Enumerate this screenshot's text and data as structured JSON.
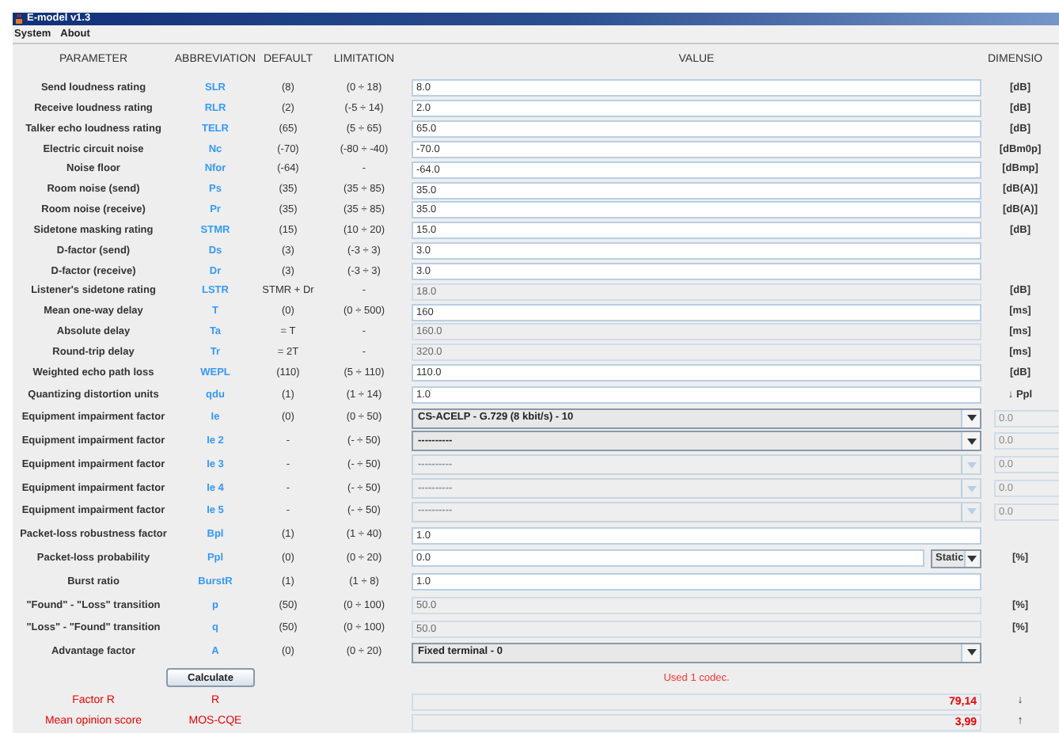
{
  "window": {
    "title": "E-model v1.3"
  },
  "menu": [
    "System",
    "About"
  ],
  "columns": [
    "PARAMETER",
    "ABBREVIATION",
    "DEFAULT",
    "LIMITATION",
    "VALUE",
    "DIMENSIO"
  ],
  "rows": [
    {
      "parameter": "Send loudness rating",
      "abbreviation": "SLR",
      "default": "(8)",
      "limitation": "(0 ÷ 18)",
      "kind": "input",
      "value": "8.0",
      "dimension": "[dB]"
    },
    {
      "parameter": "Receive loudness rating",
      "abbreviation": "RLR",
      "default": "(2)",
      "limitation": "(-5 ÷ 14)",
      "kind": "input",
      "value": "2.0",
      "dimension": "[dB]"
    },
    {
      "parameter": "Talker echo loudness rating",
      "abbreviation": "TELR",
      "default": "(65)",
      "limitation": "(5 ÷ 65)",
      "kind": "input",
      "value": "65.0",
      "dimension": "[dB]"
    },
    {
      "parameter": "Electric circuit noise",
      "abbreviation": "Nc",
      "default": "(-70)",
      "limitation": "(-80 ÷ -40)",
      "kind": "input",
      "value": "-70.0",
      "dimension": "[dBm0p]"
    },
    {
      "parameter": "Noise floor",
      "abbreviation": "Nfor",
      "default": "(-64)",
      "limitation": "-",
      "kind": "input",
      "value": "-64.0",
      "dimension": "[dBmp]"
    },
    {
      "parameter": "Room noise (send)",
      "abbreviation": "Ps",
      "default": "(35)",
      "limitation": "(35 ÷ 85)",
      "kind": "input",
      "value": "35.0",
      "dimension": "[dB(A)]"
    },
    {
      "parameter": "Room noise (receive)",
      "abbreviation": "Pr",
      "default": "(35)",
      "limitation": "(35 ÷ 85)",
      "kind": "input",
      "value": "35.0",
      "dimension": "[dB(A)]"
    },
    {
      "parameter": "Sidetone masking rating",
      "abbreviation": "STMR",
      "default": "(15)",
      "limitation": "(10 ÷ 20)",
      "kind": "input",
      "value": "15.0",
      "dimension": "[dB]"
    },
    {
      "parameter": "D-factor (send)",
      "abbreviation": "Ds",
      "default": "(3)",
      "limitation": "(-3 ÷ 3)",
      "kind": "input",
      "value": "3.0"
    },
    {
      "parameter": "D-factor (receive)",
      "abbreviation": "Dr",
      "default": "(3)",
      "limitation": "(-3 ÷ 3)",
      "kind": "input",
      "value": "3.0"
    },
    {
      "parameter": "Listener's sidetone rating",
      "abbreviation": "LSTR",
      "default": "STMR + Dr",
      "limitation": "-",
      "kind": "readonly",
      "value": "18.0",
      "dimension": "[dB]"
    },
    {
      "parameter": "Mean one-way delay",
      "abbreviation": "T",
      "default": "(0)",
      "limitation": "(0 ÷ 500)",
      "kind": "input",
      "value": "160",
      "dimension": "[ms]"
    },
    {
      "parameter": "Absolute delay",
      "abbreviation": "Ta",
      "default": "= T",
      "limitation": "-",
      "kind": "readonly",
      "value": "160.0",
      "dimension": "[ms]"
    },
    {
      "parameter": "Round-trip delay",
      "abbreviation": "Tr",
      "default": "= 2T",
      "limitation": "-",
      "kind": "readonly",
      "value": "320.0",
      "dimension": "[ms]"
    },
    {
      "parameter": "Weighted echo path loss",
      "abbreviation": "WEPL",
      "default": "(110)",
      "limitation": "(5 ÷ 110)",
      "kind": "input",
      "value": "110.0",
      "dimension": "[dB]"
    },
    {
      "parameter": "Quantizing distortion units",
      "abbreviation": "qdu",
      "default": "(1)",
      "limitation": "(1 ÷ 14)",
      "kind": "input",
      "value": "1.0",
      "dimension": "↓ Ppl"
    },
    {
      "parameter": "Equipment impairment factor",
      "abbreviation": "Ie",
      "default": "(0)",
      "limitation": "(0 ÷ 50)",
      "kind": "select",
      "disabled": false,
      "value": "CS-ACELP - G.729 (8 kbit/s) - 10",
      "side_value": "0.0"
    },
    {
      "parameter": "Equipment impairment factor",
      "abbreviation": "Ie 2",
      "default": "-",
      "limitation": "(- ÷ 50)",
      "kind": "select",
      "disabled": false,
      "value": "----------",
      "side_value": "0.0"
    },
    {
      "parameter": "Equipment impairment factor",
      "abbreviation": "Ie 3",
      "default": "-",
      "limitation": "(- ÷ 50)",
      "kind": "select",
      "disabled": true,
      "value": "----------",
      "side_value": "0.0"
    },
    {
      "parameter": "Equipment impairment factor",
      "abbreviation": "Ie 4",
      "default": "-",
      "limitation": "(- ÷ 50)",
      "kind": "select",
      "disabled": true,
      "value": "----------",
      "side_value": "0.0"
    },
    {
      "parameter": "Equipment impairment factor",
      "abbreviation": "Ie 5",
      "default": "-",
      "limitation": "(- ÷ 50)",
      "kind": "select",
      "disabled": true,
      "value": "----------",
      "side_value": "0.0"
    },
    {
      "parameter": "Packet-loss robustness factor",
      "abbreviation": "Bpl",
      "default": "(1)",
      "limitation": "(1 ÷ 40)",
      "kind": "input",
      "value": "1.0"
    },
    {
      "parameter": "Packet-loss probability",
      "abbreviation": "Ppl",
      "default": "(0)",
      "limitation": "(0 ÷ 20)",
      "kind": "input_mode",
      "value": "0.0",
      "mode": "Static",
      "dimension": "[%]"
    },
    {
      "parameter": "Burst ratio",
      "abbreviation": "BurstR",
      "default": "(1)",
      "limitation": "(1 ÷ 8)",
      "kind": "input",
      "value": "1.0"
    },
    {
      "parameter": "\"Found\" - \"Loss\" transition",
      "abbreviation": "p",
      "default": "(50)",
      "limitation": "(0 ÷ 100)",
      "kind": "readonly",
      "value": "50.0",
      "dimension": "[%]"
    },
    {
      "parameter": "\"Loss\" - \"Found\" transition",
      "abbreviation": "q",
      "default": "(50)",
      "limitation": "(0 ÷ 100)",
      "kind": "readonly",
      "value": "50.0",
      "dimension": "[%]"
    },
    {
      "parameter": "Advantage factor",
      "abbreviation": "A",
      "default": "(0)",
      "limitation": "(0 ÷ 20)",
      "kind": "select",
      "disabled": false,
      "value": "Fixed terminal - 0"
    }
  ],
  "calculate_button": "Calculate",
  "status_message": "Used 1 codec.",
  "results": [
    {
      "parameter": "Factor R",
      "abbreviation": "R",
      "value": "79,14",
      "dimension": "↓"
    },
    {
      "parameter": "Mean opinion score",
      "abbreviation": "MOS-CQE",
      "value": "3,99",
      "dimension": "↑"
    }
  ]
}
